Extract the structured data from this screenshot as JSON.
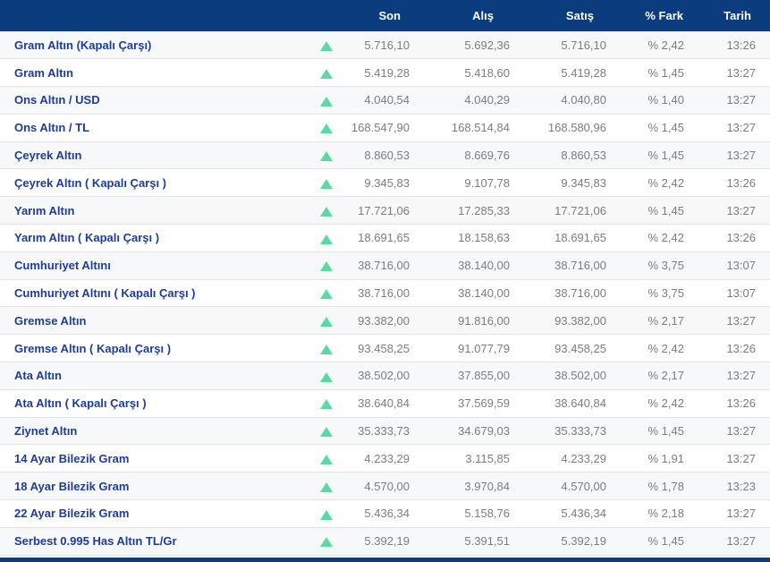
{
  "table": {
    "columns": {
      "son": "Son",
      "alis": "Alış",
      "satis": "Satış",
      "fark": "% Fark",
      "tarih": "Tarih"
    },
    "rows": [
      {
        "name": "Gram Altın (Kapalı Çarşı)",
        "trend": "up",
        "son": "5.716,10",
        "alis": "5.692,36",
        "satis": "5.716,10",
        "fark": "% 2,42",
        "tarih": "13:26"
      },
      {
        "name": "Gram Altın",
        "trend": "up",
        "son": "5.419,28",
        "alis": "5.418,60",
        "satis": "5.419,28",
        "fark": "% 1,45",
        "tarih": "13:27"
      },
      {
        "name": "Ons Altın / USD",
        "trend": "up",
        "son": "4.040,54",
        "alis": "4.040,29",
        "satis": "4.040,80",
        "fark": "% 1,40",
        "tarih": "13:27"
      },
      {
        "name": "Ons Altın / TL",
        "trend": "up",
        "son": "168.547,90",
        "alis": "168.514,84",
        "satis": "168.580,96",
        "fark": "% 1,45",
        "tarih": "13:27"
      },
      {
        "name": "Çeyrek Altın",
        "trend": "up",
        "son": "8.860,53",
        "alis": "8.669,76",
        "satis": "8.860,53",
        "fark": "% 1,45",
        "tarih": "13:27"
      },
      {
        "name": "Çeyrek Altın ( Kapalı Çarşı )",
        "trend": "up",
        "son": "9.345,83",
        "alis": "9.107,78",
        "satis": "9.345,83",
        "fark": "% 2,42",
        "tarih": "13:26"
      },
      {
        "name": "Yarım Altın",
        "trend": "up",
        "son": "17.721,06",
        "alis": "17.285,33",
        "satis": "17.721,06",
        "fark": "% 1,45",
        "tarih": "13:27"
      },
      {
        "name": "Yarım Altın ( Kapalı Çarşı )",
        "trend": "up",
        "son": "18.691,65",
        "alis": "18.158,63",
        "satis": "18.691,65",
        "fark": "% 2,42",
        "tarih": "13:26"
      },
      {
        "name": "Cumhuriyet Altını",
        "trend": "up",
        "son": "38.716,00",
        "alis": "38.140,00",
        "satis": "38.716,00",
        "fark": "% 3,75",
        "tarih": "13:07"
      },
      {
        "name": "Cumhuriyet Altını ( Kapalı Çarşı )",
        "trend": "up",
        "son": "38.716,00",
        "alis": "38.140,00",
        "satis": "38.716,00",
        "fark": "% 3,75",
        "tarih": "13:07"
      },
      {
        "name": "Gremse Altın",
        "trend": "up",
        "son": "93.382,00",
        "alis": "91.816,00",
        "satis": "93.382,00",
        "fark": "% 2,17",
        "tarih": "13:27"
      },
      {
        "name": "Gremse Altın ( Kapalı Çarşı )",
        "trend": "up",
        "son": "93.458,25",
        "alis": "91.077,79",
        "satis": "93.458,25",
        "fark": "% 2,42",
        "tarih": "13:26"
      },
      {
        "name": "Ata Altın",
        "trend": "up",
        "son": "38.502,00",
        "alis": "37.855,00",
        "satis": "38.502,00",
        "fark": "% 2,17",
        "tarih": "13:27"
      },
      {
        "name": "Ata Altın ( Kapalı Çarşı )",
        "trend": "up",
        "son": "38.640,84",
        "alis": "37.569,59",
        "satis": "38.640,84",
        "fark": "% 2,42",
        "tarih": "13:26"
      },
      {
        "name": "Ziynet Altın",
        "trend": "up",
        "son": "35.333,73",
        "alis": "34.679,03",
        "satis": "35.333,73",
        "fark": "% 1,45",
        "tarih": "13:27"
      },
      {
        "name": "14 Ayar Bilezik Gram",
        "trend": "up",
        "son": "4.233,29",
        "alis": "3.115,85",
        "satis": "4.233,29",
        "fark": "% 1,91",
        "tarih": "13:27"
      },
      {
        "name": "18 Ayar Bilezik Gram",
        "trend": "up",
        "son": "4.570,00",
        "alis": "3.970,84",
        "satis": "4.570,00",
        "fark": "% 1,78",
        "tarih": "13:23"
      },
      {
        "name": "22 Ayar Bilezik Gram",
        "trend": "up",
        "son": "5.436,34",
        "alis": "5.158,76",
        "satis": "5.436,34",
        "fark": "% 2,18",
        "tarih": "13:27"
      },
      {
        "name": "Serbest 0.995 Has Altın TL/Gr",
        "trend": "up",
        "son": "5.392,19",
        "alis": "5.391,51",
        "satis": "5.392,19",
        "fark": "% 1,45",
        "tarih": "13:27"
      }
    ]
  },
  "icons": {
    "up_arrow": "up-arrow-icon"
  },
  "colors": {
    "header_bg": "#0b3c7d",
    "header_text": "#ffffff",
    "label_color": "#1e3c9b",
    "value_color": "#7b7d82",
    "arrow_up_color": "#5bd99f",
    "border_color": "#e3e4e6",
    "row_alt_bg": "#f7f8f9",
    "bottom_bar_bg": "#0b3c7d"
  }
}
